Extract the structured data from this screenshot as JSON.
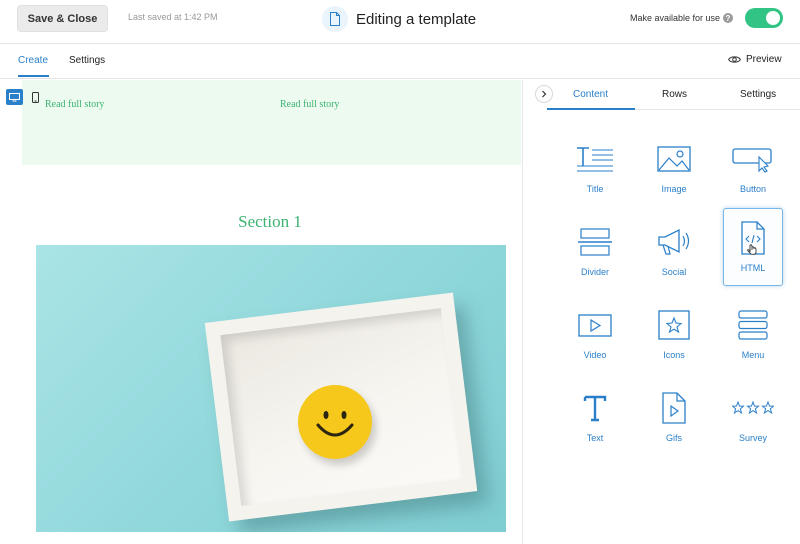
{
  "header": {
    "save_close": "Save & Close",
    "last_saved": "Last saved at 1:42 PM",
    "title": "Editing a template",
    "available_label": "Make available for use",
    "help": "?",
    "toggle_on": true
  },
  "subnav": {
    "tabs": [
      "Create",
      "Settings"
    ],
    "preview": "Preview"
  },
  "canvas": {
    "read_links": [
      "Read full story",
      "Read full story"
    ],
    "section_title": "Section 1"
  },
  "panel": {
    "tabs": [
      "Content",
      "Rows",
      "Settings"
    ],
    "blocks": [
      {
        "label": "Title",
        "icon": "title-icon"
      },
      {
        "label": "Image",
        "icon": "image-icon"
      },
      {
        "label": "Button",
        "icon": "button-icon"
      },
      {
        "label": "Divider",
        "icon": "divider-icon"
      },
      {
        "label": "Social",
        "icon": "megaphone-icon"
      },
      {
        "label": "HTML",
        "icon": "html-file-icon"
      },
      {
        "label": "Video",
        "icon": "video-icon"
      },
      {
        "label": "Icons",
        "icon": "star-icon"
      },
      {
        "label": "Menu",
        "icon": "menu-icon"
      },
      {
        "label": "Text",
        "icon": "text-icon"
      },
      {
        "label": "Gifs",
        "icon": "gif-file-icon"
      },
      {
        "label": "Survey",
        "icon": "stars-icon"
      }
    ]
  },
  "colors": {
    "accent": "#2a7fc9",
    "toggle": "#32c485",
    "green_text": "#3cb371",
    "green_block": "#ecfaf0"
  }
}
